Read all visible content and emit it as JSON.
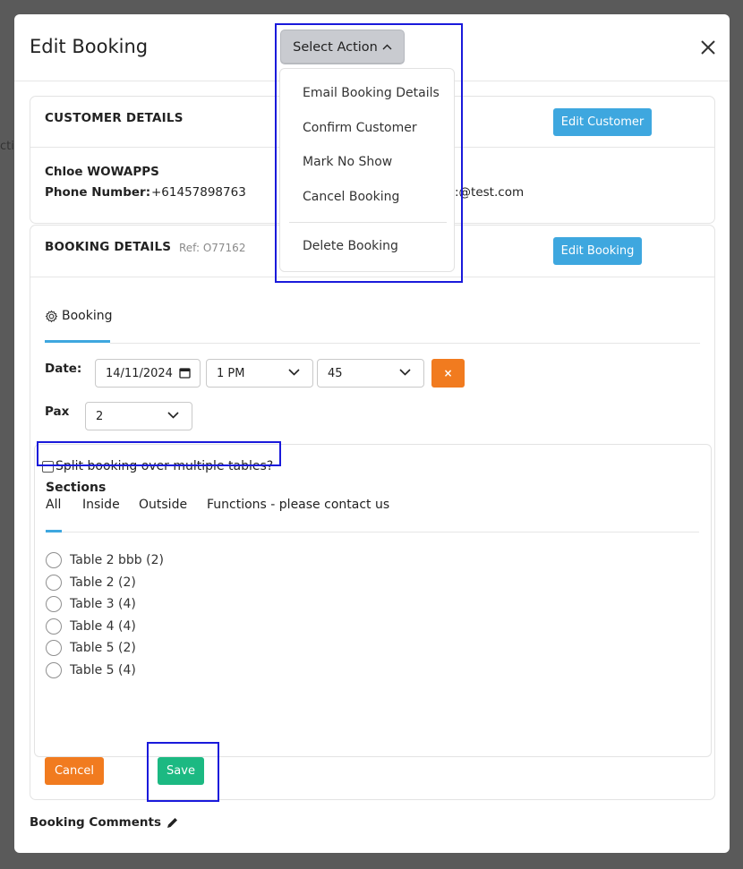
{
  "modal": {
    "title": "Edit Booking",
    "select_action_label": "Select Action"
  },
  "action_menu": {
    "items": [
      "Email Booking Details",
      "Confirm Customer",
      "Mark No Show",
      "Cancel Booking"
    ],
    "danger_item": "Delete Booking"
  },
  "customer": {
    "section_title": "CUSTOMER DETAILS",
    "edit_label": "Edit Customer",
    "name": "Chloe WOWAPPS",
    "phone_label": "Phone Number:",
    "phone_value": "+61457898763",
    "email_partial": ":@test.com"
  },
  "booking": {
    "section_title": "BOOKING DETAILS",
    "ref": "Ref: O77162",
    "edit_label": "Edit Booking",
    "tab_label": "Booking",
    "date_label": "Date:",
    "date_value": "14/11/2024",
    "time_value": "1 PM",
    "minute_value": "45",
    "clear_label": "×",
    "pax_label": "Pax",
    "pax_value": "2",
    "split_label": "Split booking over multiple tables?",
    "sections_label": "Sections",
    "sections": [
      "All",
      "Inside",
      "Outside",
      "Functions - please contact us"
    ],
    "tables": [
      "Table 2 bbb (2)",
      "Table 2 (2)",
      "Table 3 (4)",
      "Table 4 (4)",
      "Table 5 (2)",
      "Table 5 (4)"
    ],
    "cancel_label": "Cancel",
    "save_label": "Save"
  },
  "comments": {
    "label": "Booking Comments"
  },
  "colors": {
    "primary": "#3ea7df",
    "orange": "#f17b1f",
    "green": "#1cb982",
    "highlight": "#1a1adb"
  }
}
